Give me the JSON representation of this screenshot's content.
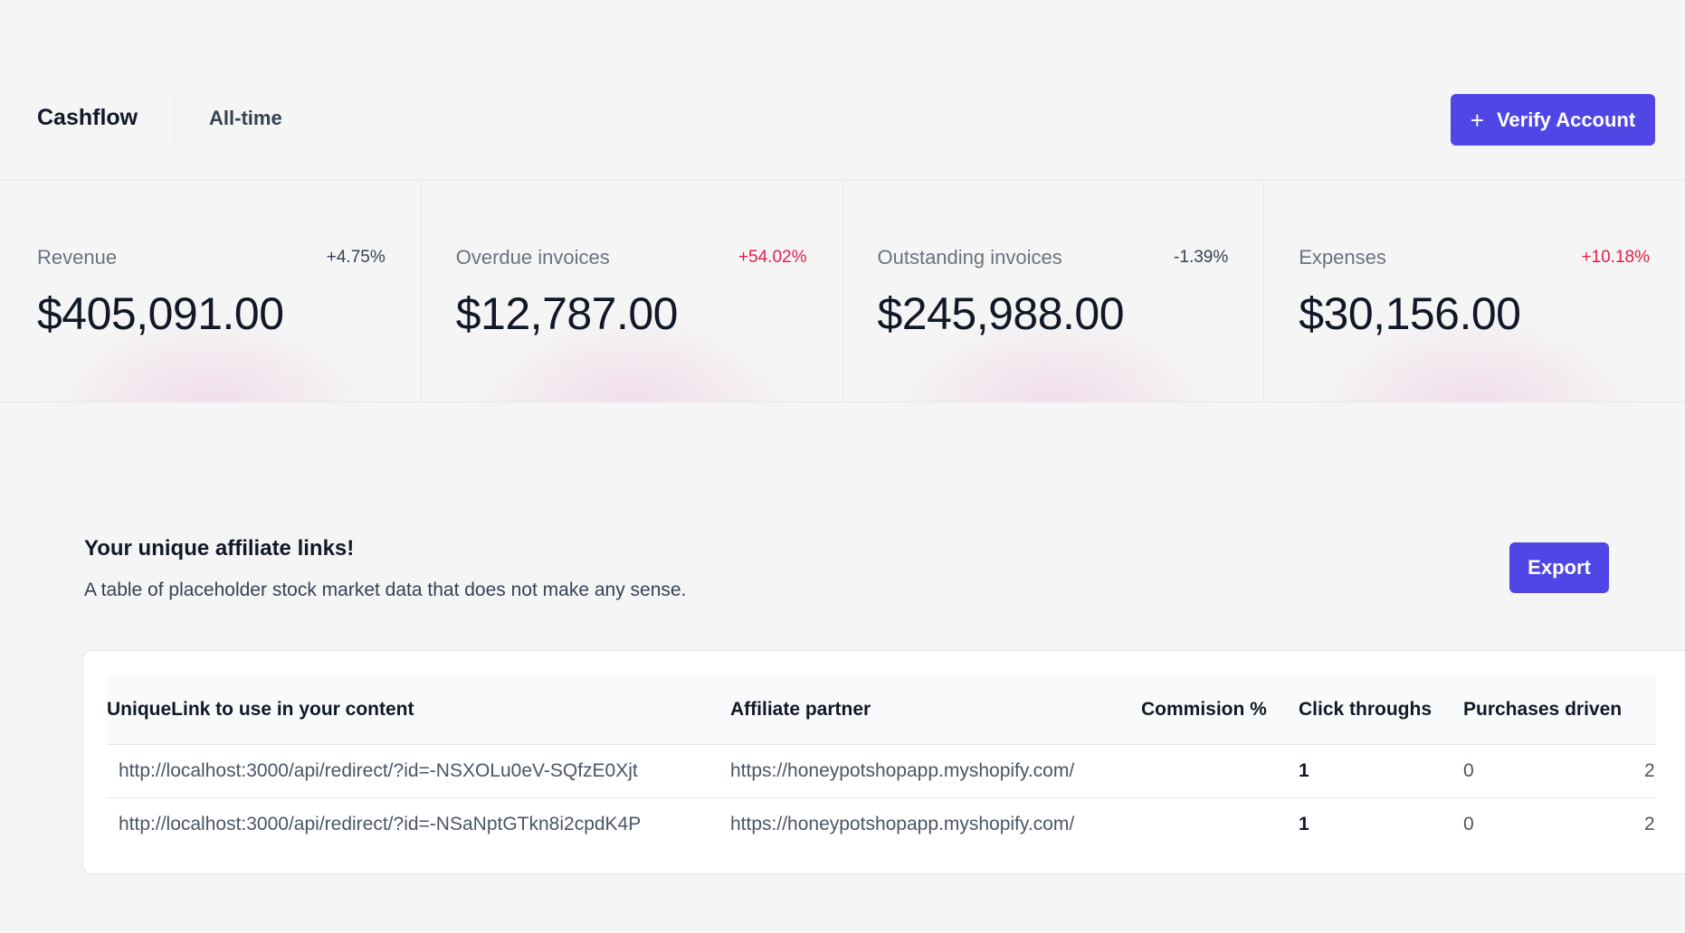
{
  "header": {
    "title": "Cashflow",
    "range": "All-time",
    "verify_button": {
      "icon": "plus-icon",
      "label": "Verify Account"
    }
  },
  "stats": [
    {
      "label": "Revenue",
      "change": "+4.75%",
      "change_color": "#374151",
      "value": "$405,091.00"
    },
    {
      "label": "Overdue invoices",
      "change": "+54.02%",
      "change_color": "#e11d48",
      "value": "$12,787.00"
    },
    {
      "label": "Outstanding invoices",
      "change": "-1.39%",
      "change_color": "#374151",
      "value": "$245,988.00"
    },
    {
      "label": "Expenses",
      "change": "+10.18%",
      "change_color": "#e11d48",
      "value": "$30,156.00"
    }
  ],
  "affiliate": {
    "title": "Your unique affiliate links!",
    "description": "A table of placeholder stock market data that does not make any sense.",
    "export_label": "Export",
    "columns": [
      "UniqueLink to use in your content",
      "Affiliate partner",
      "Commision %",
      "Click throughs",
      "Purchases driven"
    ],
    "rows": [
      {
        "link": "http://localhost:3000/api/redirect/?id=-NSXOLu0eV-SQfzE0Xjt",
        "partner": "https://honeypotshopapp.myshopify.com/",
        "commission": "",
        "clicks": "1",
        "purchases": "0",
        "extra": "2"
      },
      {
        "link": "http://localhost:3000/api/redirect/?id=-NSaNptGTkn8i2cpdK4P",
        "partner": "https://honeypotshopapp.myshopify.com/",
        "commission": "",
        "clicks": "1",
        "purchases": "0",
        "extra": "2"
      }
    ]
  },
  "colors": {
    "accent": "#4f46e5",
    "negative": "#e11d48"
  }
}
